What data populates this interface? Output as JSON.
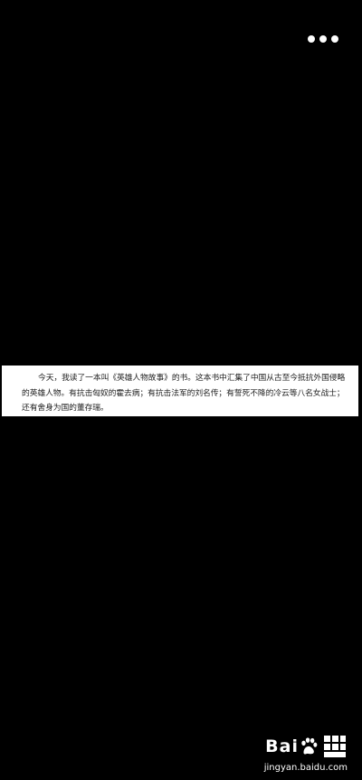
{
  "toolbar": {
    "more_icon": "more-dots-icon"
  },
  "content": {
    "paragraph": "今天，我读了一本叫《英雄人物故事》的书。这本书中汇集了中国从古至今抵抗外国侵略的英雄人物。有抗击匈奴的霍去病；有抗击法军的刘名传；有誓死不降的冷云等八名女战士；还有舍身为国的董存瑞。"
  },
  "watermark": {
    "brand": "Bai",
    "url": "jingyan.baidu.com",
    "logo_icon": "baidu-paw-icon",
    "experience_icon": "jingyan-grid-icon"
  },
  "colors": {
    "background": "#000000",
    "card": "#ffffff",
    "text": "#222222"
  }
}
